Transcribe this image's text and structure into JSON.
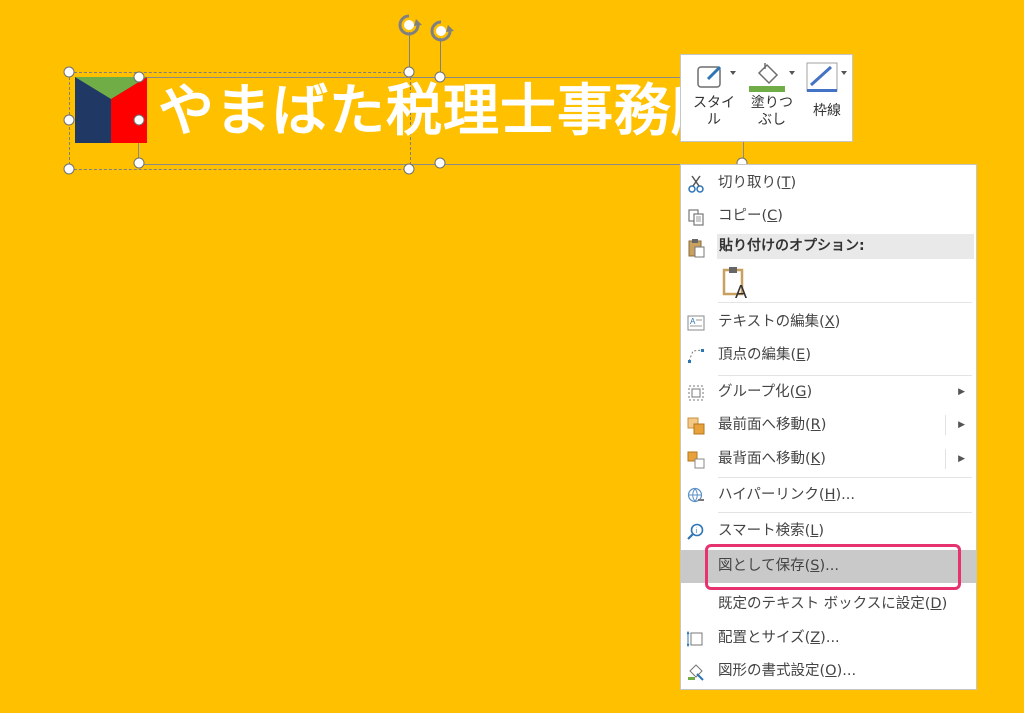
{
  "slide": {
    "title_text": "やまばた税理士事務所",
    "background": "#FFC000",
    "logo_colors": {
      "left": "#1F3864",
      "right": "#FF0000",
      "top": "#70AD47"
    }
  },
  "mini_toolbar": {
    "style": {
      "label_line1": "スタイ",
      "label_line2": "ル",
      "icon": "shape-style-icon"
    },
    "fill": {
      "label_line1": "塗りつ",
      "label_line2": "ぶし",
      "icon": "paint-bucket-icon",
      "color": "#70AD47"
    },
    "outline": {
      "label": "枠線",
      "icon": "pen-outline-icon",
      "color": "#4472C4"
    }
  },
  "context_menu": {
    "items": [
      {
        "label": "切り取り(",
        "key": "T",
        "suffix": ")",
        "icon": "scissors-icon"
      },
      {
        "label": "コピー(",
        "key": "C",
        "suffix": ")",
        "icon": "copy-icon"
      }
    ],
    "paste_header": "貼り付けのオプション:",
    "paste_option_icon": "paste-keep-text-only-icon",
    "items2": [
      {
        "label": "テキストの編集(",
        "key": "X",
        "suffix": ")",
        "icon": "edit-text-icon"
      },
      {
        "label": "頂点の編集(",
        "key": "E",
        "suffix": ")",
        "icon": "edit-points-icon"
      },
      {
        "label": "グループ化(",
        "key": "G",
        "suffix": ")",
        "icon": "group-icon",
        "submenu": true
      },
      {
        "label": "最前面へ移動(",
        "key": "R",
        "suffix": ")",
        "icon": "bring-to-front-icon",
        "submenu": true
      },
      {
        "label": "最背面へ移動(",
        "key": "K",
        "suffix": ")",
        "icon": "send-to-back-icon",
        "submenu": true
      },
      {
        "label": "ハイパーリンク(",
        "key": "H",
        "suffix": ")...",
        "icon": "hyperlink-icon"
      },
      {
        "label": "スマート検索(",
        "key": "L",
        "suffix": ")",
        "icon": "smart-lookup-icon"
      },
      {
        "label": "図として保存(",
        "key": "S",
        "suffix": ")...",
        "icon": "",
        "highlighted": true
      },
      {
        "label": "既定のテキスト ボックスに設定(",
        "key": "D",
        "suffix": ")",
        "icon": ""
      },
      {
        "label": "配置とサイズ(",
        "key": "Z",
        "suffix": ")...",
        "icon": "size-position-icon"
      },
      {
        "label": "図形の書式設定(",
        "key": "O",
        "suffix": ")...",
        "icon": "format-shape-icon"
      }
    ]
  },
  "callout_color": "#E6336F"
}
